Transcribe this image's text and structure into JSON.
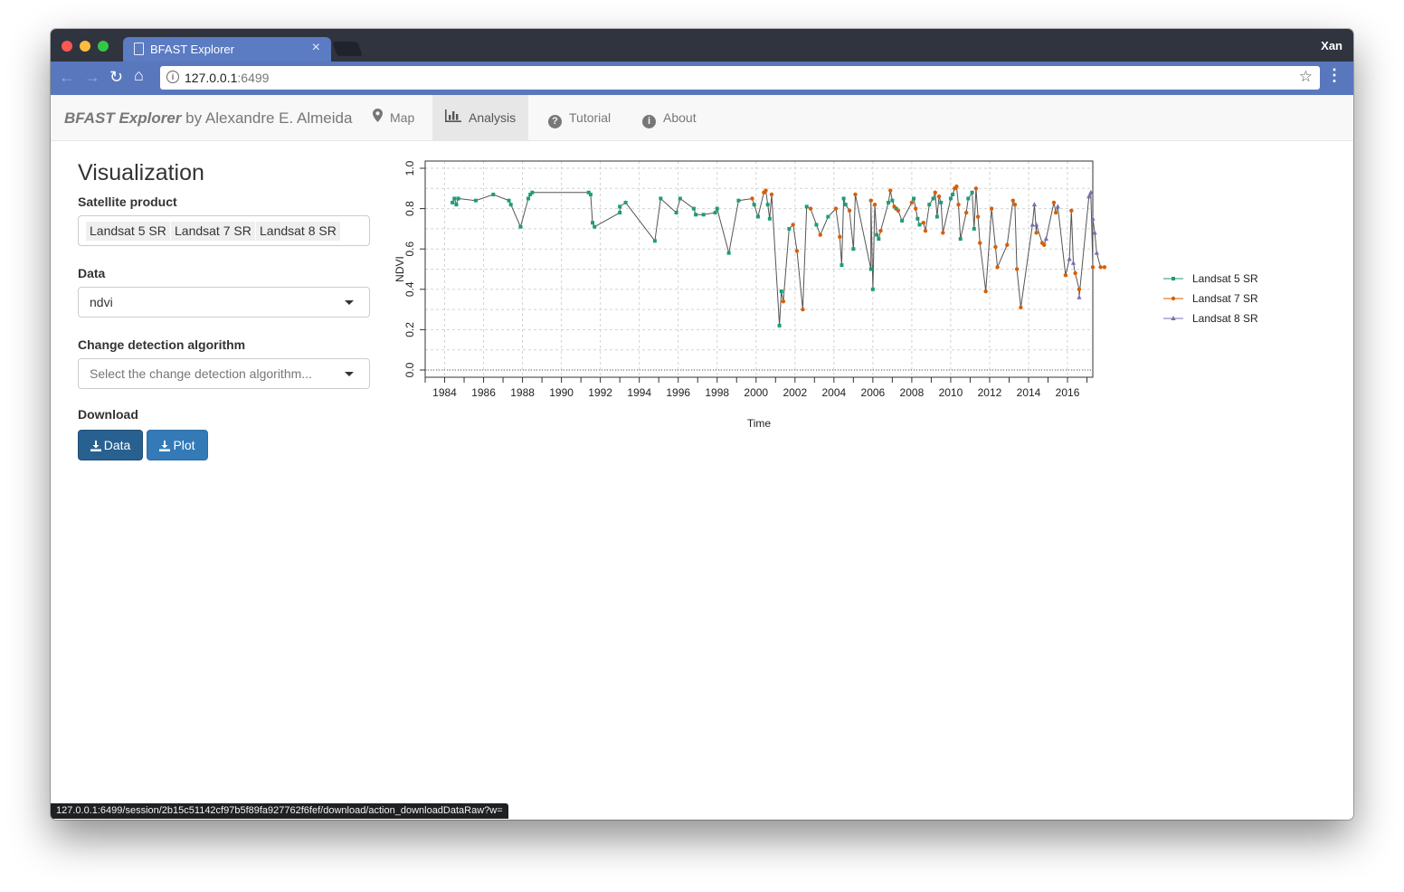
{
  "browser": {
    "tab_title": "BFAST Explorer",
    "tab_close": "×",
    "user": "Xan",
    "url_host": "127.0.0.1",
    "url_port": ":6499",
    "status_url": "127.0.0.1:6499/session/2b15c51142cf97b5f89fa927762f6fef/download/action_downloadDataRaw?w="
  },
  "app": {
    "brand_name": "BFAST Explorer",
    "brand_by": " by Alexandre E. Almeida",
    "nav": [
      {
        "label": "Map",
        "icon": "map-marker-icon"
      },
      {
        "label": "Analysis",
        "icon": "bar-chart-icon",
        "active": true
      },
      {
        "label": "Tutorial",
        "icon": "question-circle-icon"
      },
      {
        "label": "About",
        "icon": "info-circle-icon"
      }
    ]
  },
  "sidebar": {
    "title": "Visualization",
    "satellite_label": "Satellite product",
    "satellite_chips": [
      "Landsat 5 SR",
      "Landsat 7 SR",
      "Landsat 8 SR"
    ],
    "data_label": "Data",
    "data_value": "ndvi",
    "algo_label": "Change detection algorithm",
    "algo_placeholder": "Select the change detection algorithm...",
    "download_label": "Download",
    "btn_data": "Data",
    "btn_plot": "Plot"
  },
  "chart_data": {
    "type": "line",
    "xlabel": "Time",
    "ylabel": "NDVI",
    "xlim": [
      1983,
      2017.3
    ],
    "ylim": [
      0,
      1
    ],
    "x_ticks": [
      1984,
      1986,
      1988,
      1990,
      1992,
      1994,
      1996,
      1998,
      2000,
      2002,
      2004,
      2006,
      2008,
      2010,
      2012,
      2014,
      2016
    ],
    "y_ticks": [
      "0.0",
      "0.2",
      "0.4",
      "0.6",
      "0.8",
      "1.0"
    ],
    "y_tick_values": [
      0,
      0.2,
      0.4,
      0.6,
      0.8,
      1.0
    ],
    "grid": true,
    "legend_position": "right",
    "line_color": "#555555",
    "series": [
      {
        "name": "Landsat 5 SR",
        "color": "#1b9e77",
        "marker": "square",
        "points": [
          [
            1984.4,
            0.83
          ],
          [
            1984.5,
            0.85
          ],
          [
            1984.6,
            0.82
          ],
          [
            1984.7,
            0.85
          ],
          [
            1985.6,
            0.84
          ],
          [
            1986.5,
            0.87
          ],
          [
            1987.3,
            0.84
          ],
          [
            1987.4,
            0.82
          ],
          [
            1987.9,
            0.71
          ],
          [
            1988.3,
            0.85
          ],
          [
            1988.4,
            0.87
          ],
          [
            1988.5,
            0.88
          ],
          [
            1991.4,
            0.88
          ],
          [
            1991.5,
            0.87
          ],
          [
            1991.6,
            0.73
          ],
          [
            1991.7,
            0.71
          ],
          [
            1993,
            0.78
          ],
          [
            1993,
            0.81
          ],
          [
            1993.3,
            0.83
          ],
          [
            1994.8,
            0.64
          ],
          [
            1995.1,
            0.85
          ],
          [
            1995.9,
            0.78
          ],
          [
            1996.1,
            0.85
          ],
          [
            1996.8,
            0.8
          ],
          [
            1996.9,
            0.77
          ],
          [
            1997.3,
            0.77
          ],
          [
            1997.9,
            0.78
          ],
          [
            1998,
            0.8
          ],
          [
            1998.6,
            0.58
          ],
          [
            1999.1,
            0.84
          ],
          [
            1999.9,
            0.82
          ],
          [
            2000.1,
            0.76
          ],
          [
            2000.6,
            0.82
          ],
          [
            2000.7,
            0.75
          ],
          [
            2001.2,
            0.22
          ],
          [
            2001.3,
            0.39
          ],
          [
            2001.7,
            0.7
          ],
          [
            2002.6,
            0.81
          ],
          [
            2003.1,
            0.72
          ],
          [
            2003.7,
            0.76
          ],
          [
            2004.4,
            0.52
          ],
          [
            2004.5,
            0.85
          ],
          [
            2004.6,
            0.82
          ],
          [
            2005,
            0.6
          ],
          [
            2005.9,
            0.5
          ],
          [
            2006,
            0.4
          ],
          [
            2006.2,
            0.67
          ],
          [
            2006.3,
            0.65
          ],
          [
            2006.8,
            0.83
          ],
          [
            2007,
            0.84
          ],
          [
            2007.2,
            0.8
          ],
          [
            2007.5,
            0.74
          ],
          [
            2008.1,
            0.85
          ],
          [
            2008.3,
            0.75
          ],
          [
            2008.4,
            0.72
          ],
          [
            2008.9,
            0.82
          ],
          [
            2009.1,
            0.85
          ],
          [
            2009.3,
            0.76
          ],
          [
            2009.5,
            0.83
          ],
          [
            2010,
            0.85
          ],
          [
            2010.1,
            0.87
          ],
          [
            2010.5,
            0.65
          ],
          [
            2010.9,
            0.85
          ],
          [
            2011.1,
            0.88
          ],
          [
            2011.2,
            0.7
          ]
        ]
      },
      {
        "name": "Landsat 7 SR",
        "color": "#d95f02",
        "marker": "circle",
        "points": [
          [
            1999.8,
            0.85
          ],
          [
            2000.4,
            0.88
          ],
          [
            2000.5,
            0.89
          ],
          [
            2000.8,
            0.87
          ],
          [
            2001.4,
            0.34
          ],
          [
            2001.9,
            0.72
          ],
          [
            2002.1,
            0.59
          ],
          [
            2002.4,
            0.3
          ],
          [
            2002.8,
            0.8
          ],
          [
            2003.3,
            0.67
          ],
          [
            2004.1,
            0.8
          ],
          [
            2004.3,
            0.66
          ],
          [
            2004.8,
            0.79
          ],
          [
            2005.1,
            0.87
          ],
          [
            2005.9,
            0.84
          ],
          [
            2006.1,
            0.82
          ],
          [
            2006.4,
            0.69
          ],
          [
            2006.9,
            0.89
          ],
          [
            2007.1,
            0.81
          ],
          [
            2007.3,
            0.79
          ],
          [
            2008,
            0.83
          ],
          [
            2008.2,
            0.8
          ],
          [
            2008.6,
            0.73
          ],
          [
            2008.7,
            0.69
          ],
          [
            2009.2,
            0.88
          ],
          [
            2009.4,
            0.86
          ],
          [
            2009.6,
            0.68
          ],
          [
            2010.2,
            0.9
          ],
          [
            2010.3,
            0.91
          ],
          [
            2010.4,
            0.82
          ],
          [
            2010.8,
            0.78
          ],
          [
            2011.3,
            0.9
          ],
          [
            2011.4,
            0.76
          ],
          [
            2011.5,
            0.63
          ],
          [
            2011.8,
            0.39
          ],
          [
            2012.1,
            0.8
          ],
          [
            2012.3,
            0.61
          ],
          [
            2012.4,
            0.51
          ],
          [
            2012.9,
            0.62
          ],
          [
            2013.2,
            0.84
          ],
          [
            2013.3,
            0.82
          ],
          [
            2013.4,
            0.5
          ],
          [
            2013.6,
            0.31
          ],
          [
            2014.4,
            0.68
          ],
          [
            2014.7,
            0.63
          ],
          [
            2014.8,
            0.62
          ],
          [
            2015.3,
            0.83
          ],
          [
            2015.4,
            0.78
          ],
          [
            2015.9,
            0.47
          ],
          [
            2016.2,
            0.79
          ],
          [
            2016.4,
            0.48
          ],
          [
            2016.6,
            0.4
          ],
          [
            2017.3,
            0.51
          ],
          [
            2017.7,
            0.51
          ],
          [
            2017.9,
            0.51
          ]
        ]
      },
      {
        "name": "Landsat 8 SR",
        "color": "#7570b3",
        "marker": "triangle",
        "points": [
          [
            2014.2,
            0.72
          ],
          [
            2014.3,
            0.82
          ],
          [
            2014.4,
            0.72
          ],
          [
            2014.9,
            0.65
          ],
          [
            2015.5,
            0.81
          ],
          [
            2016.1,
            0.55
          ],
          [
            2016.3,
            0.53
          ],
          [
            2016.6,
            0.36
          ],
          [
            2017.1,
            0.86
          ],
          [
            2017.2,
            0.88
          ],
          [
            2017.3,
            0.75
          ],
          [
            2017.4,
            0.68
          ],
          [
            2017.5,
            0.58
          ]
        ]
      }
    ]
  }
}
